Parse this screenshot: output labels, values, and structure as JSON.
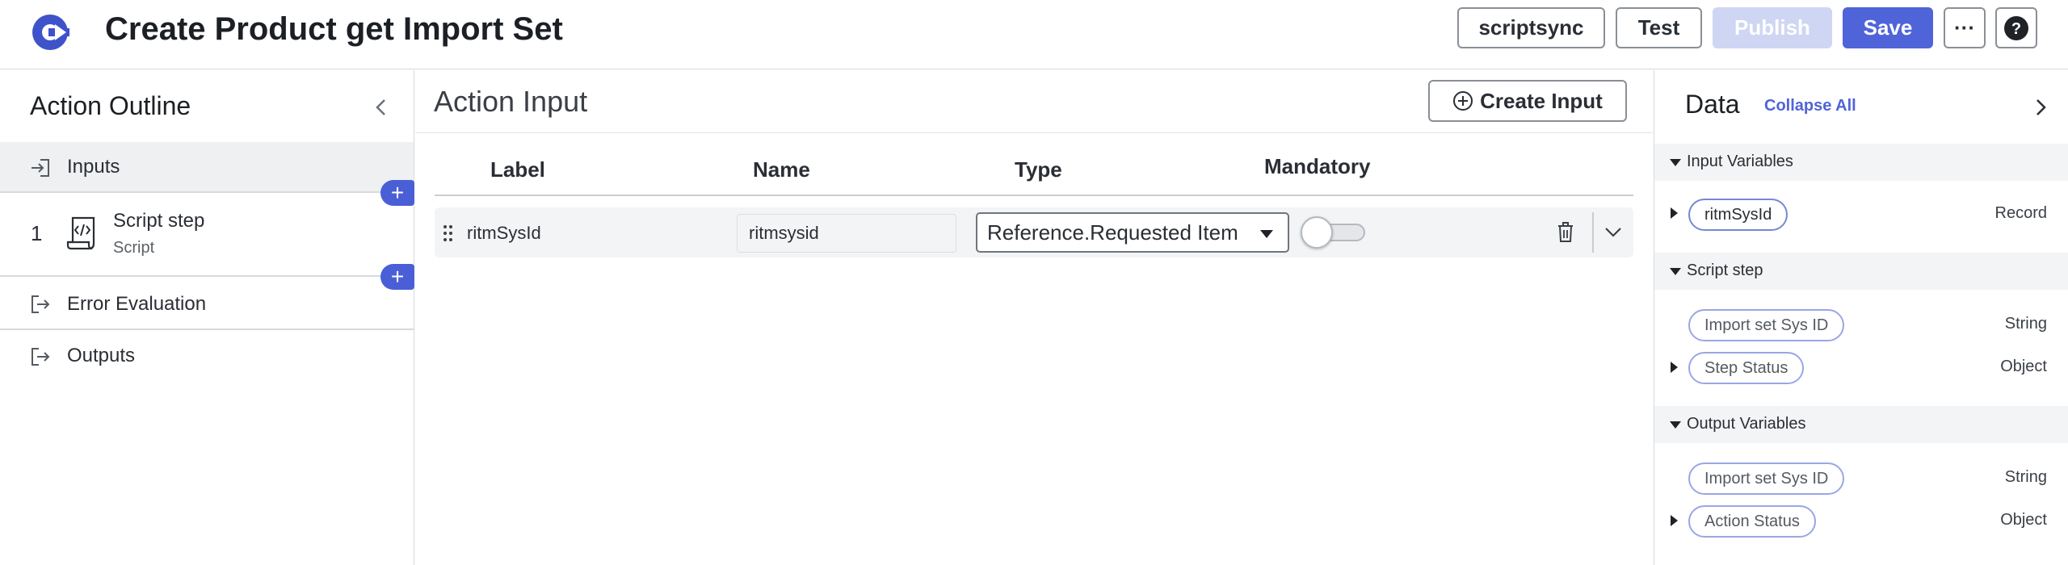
{
  "header": {
    "title": "Create Product get Import Set",
    "buttons": {
      "scriptsync": "scriptsync",
      "test": "Test",
      "publish": "Publish",
      "save": "Save",
      "more": "···",
      "help": "?"
    }
  },
  "outline": {
    "title": "Action Outline",
    "inputs_label": "Inputs",
    "step_number": "1",
    "step_name": "Script step",
    "step_type": "Script",
    "error_label": "Error Evaluation",
    "outputs_label": "Outputs",
    "add_symbol": "+"
  },
  "action_input": {
    "title": "Action Input",
    "create_button": "Create Input",
    "columns": {
      "label": "Label",
      "name": "Name",
      "type": "Type",
      "mandatory": "Mandatory"
    },
    "rows": [
      {
        "label": "ritmSysId",
        "name": "ritmsysid",
        "type": "Reference.Requested Item",
        "mandatory": false
      }
    ]
  },
  "data_panel": {
    "title": "Data",
    "collapse_all": "Collapse All",
    "sections": [
      {
        "label": "Input Variables",
        "items": [
          {
            "pill": "ritmSysId",
            "type": "Record"
          }
        ]
      },
      {
        "label": "Script step",
        "items": [
          {
            "pill": "Import set Sys ID",
            "type": "String"
          },
          {
            "pill": "Step Status",
            "type": "Object"
          }
        ]
      },
      {
        "label": "Output Variables",
        "items": [
          {
            "pill": "Import set Sys ID",
            "type": "String"
          },
          {
            "pill": "Action Status",
            "type": "Object"
          }
        ]
      }
    ]
  },
  "colors": {
    "accent": "#4f64d9",
    "publish_disabled": "#cfd6f3",
    "add_bubble": "#4a5fd6",
    "pill_border": "#9aa6e6"
  }
}
